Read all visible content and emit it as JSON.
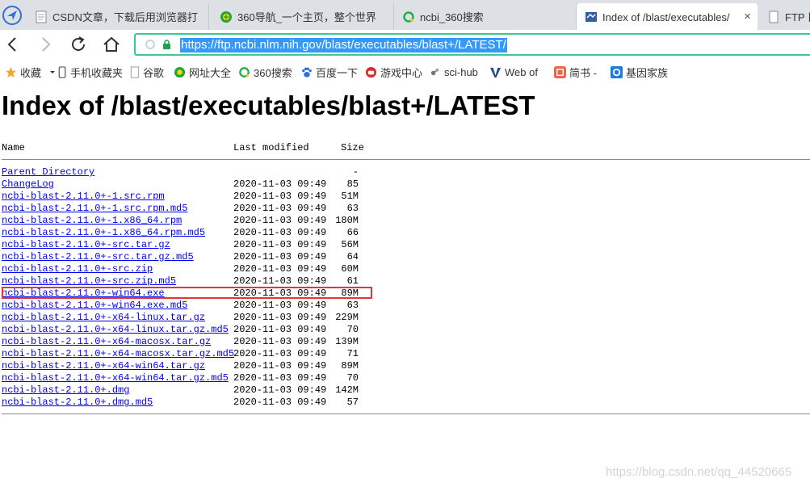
{
  "browser": {
    "tabs": [
      {
        "label": "CSDN文章，下载后用浏览器打",
        "icon": "csdn-page-icon",
        "active": false
      },
      {
        "label": "360导航_一个主页，整个世界",
        "icon": "360-nav-icon",
        "active": false
      },
      {
        "label": "ncbi_360搜索",
        "icon": "360-search-icon",
        "active": false
      },
      {
        "label": "Index of /blast/executables/",
        "icon": "ftp-folder-icon",
        "active": true,
        "close": "×"
      },
      {
        "label": "FTP 目",
        "icon": "document-icon",
        "active": false
      }
    ],
    "address_bar": {
      "url": "https://ftp.ncbi.nlm.nih.gov/blast/executables/blast+/LATEST/",
      "selection_color": "#3399ff",
      "border_color": "#42c58f"
    },
    "bookmarks": [
      {
        "label": "收藏",
        "icon": "star-icon",
        "dropdown": true
      },
      {
        "label": "手机收藏夹",
        "icon": "phone-icon"
      },
      {
        "label": "谷歌",
        "icon": "document-icon"
      },
      {
        "label": "网址大全",
        "icon": "360-nav-icon"
      },
      {
        "label": "360搜索",
        "icon": "360-search-icon"
      },
      {
        "label": "百度一下",
        "icon": "baidu-paw-icon"
      },
      {
        "label": "游戏中心",
        "icon": "game-icon"
      },
      {
        "label": "sci-hub",
        "icon": "sci-hub-icon"
      },
      {
        "label": "Web of",
        "icon": "web-of-science-icon"
      },
      {
        "label": "简书 -",
        "icon": "jianshu-icon"
      },
      {
        "label": "基因家族",
        "icon": "blue-o-icon"
      }
    ]
  },
  "page": {
    "title": "Index of /blast/executables/blast+/LATEST",
    "columns": {
      "name": "Name",
      "modified": "Last modified",
      "size": "Size"
    },
    "parent": {
      "name": "Parent Directory",
      "date": "",
      "size": "-"
    },
    "files": [
      {
        "name": "ChangeLog",
        "date": "2020-11-03 09:49",
        "size": "85"
      },
      {
        "name": "ncbi-blast-2.11.0+-1.src.rpm",
        "date": "2020-11-03 09:49",
        "size": "51M"
      },
      {
        "name": "ncbi-blast-2.11.0+-1.src.rpm.md5",
        "date": "2020-11-03 09:49",
        "size": "63"
      },
      {
        "name": "ncbi-blast-2.11.0+-1.x86_64.rpm",
        "date": "2020-11-03 09:49",
        "size": "180M"
      },
      {
        "name": "ncbi-blast-2.11.0+-1.x86_64.rpm.md5",
        "date": "2020-11-03 09:49",
        "size": "66"
      },
      {
        "name": "ncbi-blast-2.11.0+-src.tar.gz",
        "date": "2020-11-03 09:49",
        "size": "56M"
      },
      {
        "name": "ncbi-blast-2.11.0+-src.tar.gz.md5",
        "date": "2020-11-03 09:49",
        "size": "64"
      },
      {
        "name": "ncbi-blast-2.11.0+-src.zip",
        "date": "2020-11-03 09:49",
        "size": "60M"
      },
      {
        "name": "ncbi-blast-2.11.0+-src.zip.md5",
        "date": "2020-11-03 09:49",
        "size": "61"
      },
      {
        "name": "ncbi-blast-2.11.0+-win64.exe",
        "date": "2020-11-03 09:49",
        "size": "89M",
        "highlighted": true
      },
      {
        "name": "ncbi-blast-2.11.0+-win64.exe.md5",
        "date": "2020-11-03 09:49",
        "size": "63"
      },
      {
        "name": "ncbi-blast-2.11.0+-x64-linux.tar.gz",
        "date": "2020-11-03 09:49",
        "size": "229M"
      },
      {
        "name": "ncbi-blast-2.11.0+-x64-linux.tar.gz.md5",
        "date": "2020-11-03 09:49",
        "size": "70"
      },
      {
        "name": "ncbi-blast-2.11.0+-x64-macosx.tar.gz",
        "date": "2020-11-03 09:49",
        "size": "139M"
      },
      {
        "name": "ncbi-blast-2.11.0+-x64-macosx.tar.gz.md5",
        "date": "2020-11-03 09:49",
        "size": "71"
      },
      {
        "name": "ncbi-blast-2.11.0+-x64-win64.tar.gz",
        "date": "2020-11-03 09:49",
        "size": "89M"
      },
      {
        "name": "ncbi-blast-2.11.0+-x64-win64.tar.gz.md5",
        "date": "2020-11-03 09:49",
        "size": "70"
      },
      {
        "name": "ncbi-blast-2.11.0+.dmg",
        "date": "2020-11-03 09:49",
        "size": "142M"
      },
      {
        "name": "ncbi-blast-2.11.0+.dmg.md5",
        "date": "2020-11-03 09:49",
        "size": "57"
      }
    ],
    "link_color": "#0000ee",
    "highlight_color": "#e0383a"
  },
  "watermark": "https://blog.csdn.net/qq_44520665"
}
